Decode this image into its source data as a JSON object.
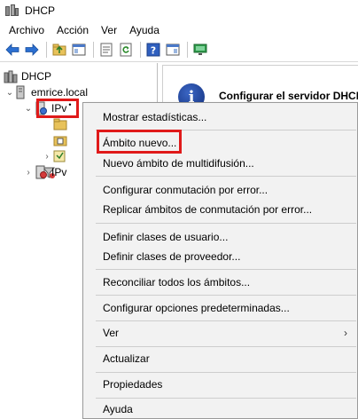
{
  "window": {
    "title": "DHCP",
    "app_icon": "dhcp-server-icon"
  },
  "menubar": {
    "items": [
      "Archivo",
      "Acción",
      "Ver",
      "Ayuda"
    ]
  },
  "toolbar": {
    "icons": [
      "back-arrow-icon",
      "forward-arrow-icon",
      "up-folder-icon",
      "show-tree-icon",
      "properties-icon",
      "refresh-icon",
      "help-icon",
      "show-action-pane-icon",
      "monitor-icon"
    ]
  },
  "tree": {
    "root": "DHCP",
    "server": "emrice.local",
    "ipv4": "IPv",
    "ipv6": "IPv"
  },
  "right_pane": {
    "title": "Configurar el servidor DHCP"
  },
  "context_menu": {
    "items": [
      "Mostrar estadísticas...",
      "Ámbito nuevo...",
      "Nuevo ámbito de multidifusión...",
      "Configurar conmutación por error...",
      "Replicar ámbitos de conmutación por error...",
      "Definir clases de usuario...",
      "Definir clases de proveedor...",
      "Reconciliar todos los ámbitos...",
      "Configurar opciones predeterminadas...",
      "Ver",
      "Actualizar",
      "Propiedades",
      "Ayuda"
    ],
    "submenu_arrow": "›"
  },
  "colors": {
    "highlight_border": "#e01a1a",
    "menu_bg": "#f2f2f2",
    "info_icon": "#1f3f9a"
  }
}
